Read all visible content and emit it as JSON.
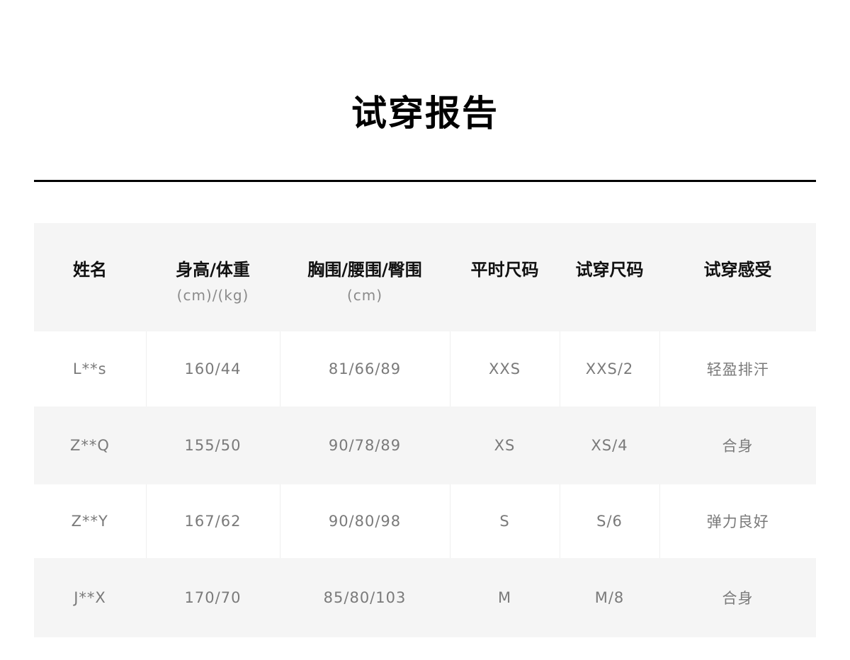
{
  "title": "试穿报告",
  "table": {
    "headers": [
      {
        "main": "姓名",
        "sub": ""
      },
      {
        "main": "身高/体重",
        "sub": "(cm)/(kg)"
      },
      {
        "main": "胸围/腰围/臀围",
        "sub": "(cm)"
      },
      {
        "main": "平时尺码",
        "sub": ""
      },
      {
        "main": "试穿尺码",
        "sub": ""
      },
      {
        "main": "试穿感受",
        "sub": ""
      }
    ],
    "rows": [
      [
        "L**s",
        "160/44",
        "81/66/89",
        "XXS",
        "XXS/2",
        "轻盈排汗"
      ],
      [
        "Z**Q",
        "155/50",
        "90/78/89",
        "XS",
        "XS/4",
        "合身"
      ],
      [
        "Z**Y",
        "167/62",
        "90/80/98",
        "S",
        "S/6",
        "弹力良好"
      ],
      [
        "J**X",
        "170/70",
        "85/80/103",
        "M",
        "M/8",
        "合身"
      ]
    ]
  },
  "colors": {
    "header_bg": "#f5f5f5",
    "alt_row_bg": "#f5f5f5",
    "cell_text": "#7a7a7a",
    "divider": "#000000"
  }
}
